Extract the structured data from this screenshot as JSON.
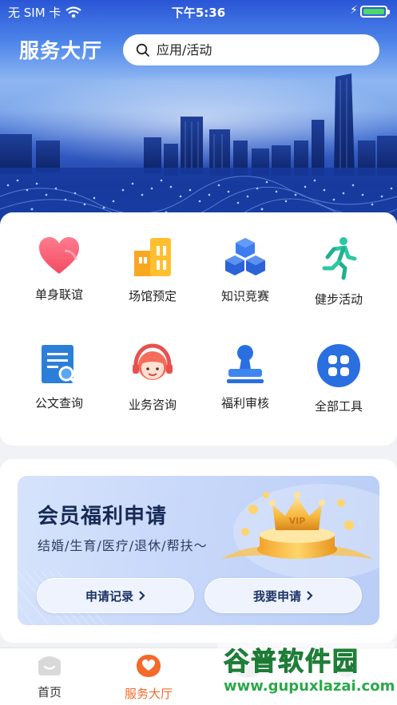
{
  "status": {
    "carrier": "无 SIM 卡",
    "time": "下午5:36"
  },
  "header": {
    "title": "服务大厅",
    "search_placeholder": "应用/活动"
  },
  "tools": [
    {
      "label": "单身联谊",
      "icon": "heart-icon"
    },
    {
      "label": "场馆预定",
      "icon": "building-icon"
    },
    {
      "label": "知识竞赛",
      "icon": "cubes-icon"
    },
    {
      "label": "健步活动",
      "icon": "runner-icon"
    },
    {
      "label": "公文查询",
      "icon": "document-search-icon"
    },
    {
      "label": "业务咨询",
      "icon": "customer-service-icon"
    },
    {
      "label": "福利审核",
      "icon": "stamp-icon"
    },
    {
      "label": "全部工具",
      "icon": "grid-apps-icon"
    }
  ],
  "benefit": {
    "title": "会员福利申请",
    "subtitle": "结婚/生育/医疗/退休/帮扶～",
    "badge": "VIP",
    "records_button": "申请记录",
    "apply_button": "我要申请"
  },
  "tabbar": [
    {
      "label": "首页"
    },
    {
      "label": "服务大厅"
    }
  ],
  "watermark": {
    "text": "谷普软件园",
    "url": "www.gupuxlazai.com"
  },
  "colors": {
    "accent": "#f36a2b",
    "primary_blue": "#2a62d8",
    "banner_text": "#152a55"
  }
}
